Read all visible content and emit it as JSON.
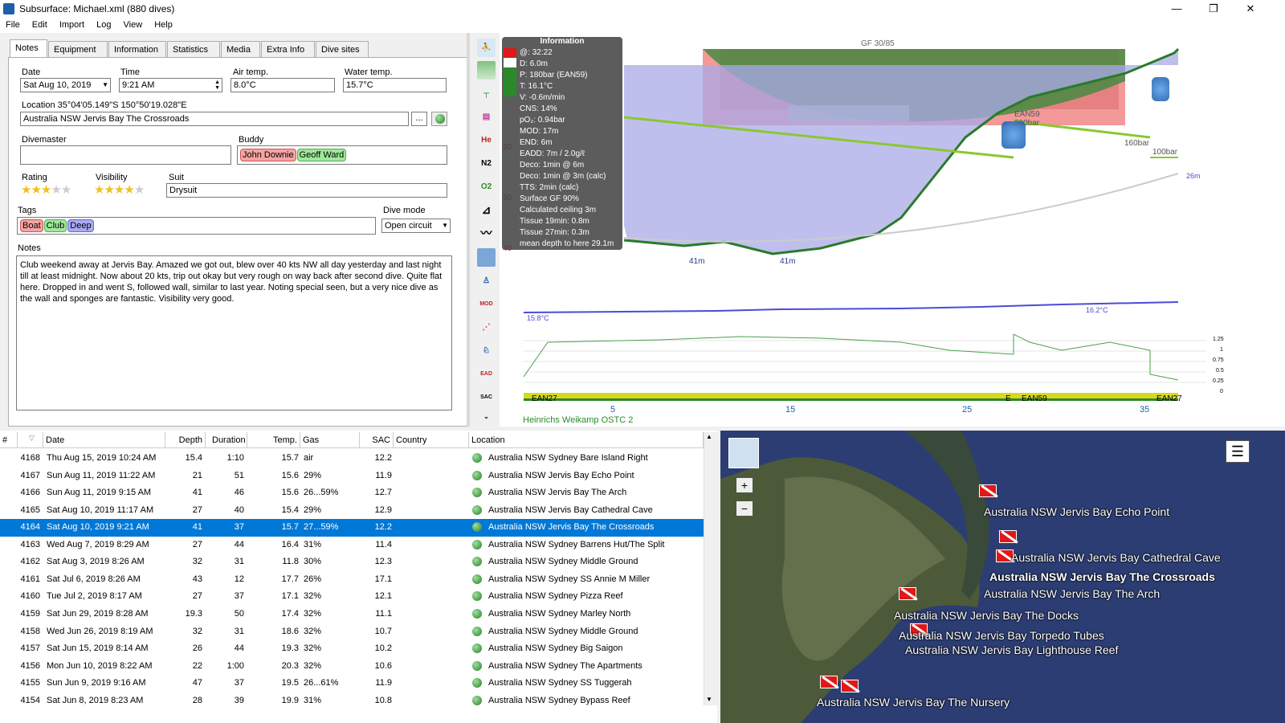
{
  "window": {
    "title": "Subsurface: Michael.xml (880 dives)",
    "minimize": "—",
    "restore": "❐",
    "close": "✕"
  },
  "menu": [
    "File",
    "Edit",
    "Import",
    "Log",
    "View",
    "Help"
  ],
  "tabs": [
    "Notes",
    "Equipment",
    "Information",
    "Statistics",
    "Media",
    "Extra Info",
    "Dive sites"
  ],
  "notes": {
    "date_label": "Date",
    "date_value": "Sat Aug 10, 2019",
    "time_label": "Time",
    "time_value": "9:21 AM",
    "air_label": "Air temp.",
    "air_value": "8.0°C",
    "water_label": "Water temp.",
    "water_value": "15.7°C",
    "location_label": "Location 35°04'05.149\"S 150°50'19.028\"E",
    "location_value": "Australia NSW Jervis Bay The Crossroads",
    "location_btn": "...",
    "divemaster_label": "Divemaster",
    "divemaster_value": "",
    "buddy_label": "Buddy",
    "buddies": [
      "John Downie",
      "Geoff Ward"
    ],
    "rating_label": "Rating",
    "rating": 3,
    "visibility_label": "Visibility",
    "visibility": 4,
    "suit_label": "Suit",
    "suit_value": "Drysuit",
    "tags_label": "Tags",
    "tags": [
      "Boat",
      "Club",
      "Deep"
    ],
    "divemode_label": "Dive mode",
    "divemode_value": "Open circuit",
    "notes_label": "Notes",
    "notes_text": "Club weekend away at Jervis Bay. Amazed we got out, blew over 40 kts NW all day yesterday and last night till at least midnight. Now about 20 kts, trip out okay but very rough on way back after second dive. Quite flat here. Dropped in and went S, followed wall, similar to last year. Noting special seen, but a very nice dive as the wall and sponges are fantastic. Visibility very good."
  },
  "toolbar": [
    "profile-icon",
    "ceiling-icon",
    "deco-icon",
    "tissue-icon",
    "He",
    "N2",
    "O2",
    "mod-icon",
    "graph-icon",
    "map-icon",
    "diver-icon",
    "MOD",
    "planner-icon",
    "gas-icon",
    "EAD",
    "SAC"
  ],
  "profile": {
    "gf_label": "GF 30/85",
    "info_title": "Information",
    "info_lines": [
      "@: 32:22",
      "D: 6.0m",
      "P: 180bar (EAN59)",
      "T: 16.1°C",
      "V: -0.6m/min",
      "CNS: 14%",
      "pO₂: 0.94bar",
      "MOD: 17m",
      "END: 6m",
      "EADD: 7m / 2.0g/ℓ",
      "Deco: 1min @ 6m",
      "Deco: 1min @ 3m (calc)",
      "TTS: 2min (calc)",
      "Surface GF 90%",
      "Calculated ceiling 3m",
      "Tissue 19min: 0.8m",
      "Tissue 27min: 0.3m",
      "mean depth to here 29.1m"
    ],
    "depth_ticks": [
      "20",
      "30",
      "40"
    ],
    "depth_labels": [
      "41m",
      "41m"
    ],
    "pressure_labels": [
      "EAN59",
      "200bar",
      "160bar",
      "100bar"
    ],
    "max_label": "26m",
    "temp_labels": [
      "15.8°C",
      "16.2°C"
    ],
    "po2_ticks": [
      "1.25",
      "1",
      "0.75",
      "0.5",
      "0.25",
      "0"
    ],
    "gas_labels": [
      "EAN27",
      "E",
      "EAN59",
      "EAN27"
    ],
    "time_ticks": [
      "5",
      "15",
      "25",
      "35"
    ],
    "computer": "Heinrichs Weikamp OSTC 2"
  },
  "divelist": {
    "headers": [
      "#",
      "Date",
      "Depth",
      "Duration",
      "Temp.",
      "Gas",
      "SAC",
      "Country",
      "Location"
    ],
    "rows": [
      {
        "n": "4168",
        "date": "Thu Aug 15, 2019 10:24 AM",
        "depth": "15.4",
        "dur": "1:10",
        "temp": "15.7",
        "gas": "air",
        "sac": "12.2",
        "loc": "Australia NSW Sydney Bare Island Right"
      },
      {
        "n": "4167",
        "date": "Sun Aug 11, 2019 11:22 AM",
        "depth": "21",
        "dur": "51",
        "temp": "15.6",
        "gas": "29%",
        "sac": "11.9",
        "loc": "Australia NSW Jervis Bay Echo Point"
      },
      {
        "n": "4166",
        "date": "Sun Aug 11, 2019 9:15 AM",
        "depth": "41",
        "dur": "46",
        "temp": "15.6",
        "gas": "26...59%",
        "sac": "12.7",
        "loc": "Australia NSW Jervis Bay The Arch"
      },
      {
        "n": "4165",
        "date": "Sat Aug 10, 2019 11:17 AM",
        "depth": "27",
        "dur": "40",
        "temp": "15.4",
        "gas": "29%",
        "sac": "12.9",
        "loc": "Australia NSW Jervis Bay Cathedral Cave"
      },
      {
        "n": "4164",
        "date": "Sat Aug 10, 2019 9:21 AM",
        "depth": "41",
        "dur": "37",
        "temp": "15.7",
        "gas": "27...59%",
        "sac": "12.2",
        "loc": "Australia NSW Jervis Bay The Crossroads",
        "sel": true
      },
      {
        "n": "4163",
        "date": "Wed Aug 7, 2019 8:29 AM",
        "depth": "27",
        "dur": "44",
        "temp": "16.4",
        "gas": "31%",
        "sac": "11.4",
        "loc": "Australia NSW Sydney Barrens Hut/The Split"
      },
      {
        "n": "4162",
        "date": "Sat Aug 3, 2019 8:26 AM",
        "depth": "32",
        "dur": "31",
        "temp": "11.8",
        "gas": "30%",
        "sac": "12.3",
        "loc": "Australia NSW Sydney Middle Ground"
      },
      {
        "n": "4161",
        "date": "Sat Jul 6, 2019 8:26 AM",
        "depth": "43",
        "dur": "12",
        "temp": "17.7",
        "gas": "26%",
        "sac": "17.1",
        "loc": "Australia NSW Sydney SS Annie M Miller"
      },
      {
        "n": "4160",
        "date": "Tue Jul 2, 2019 8:17 AM",
        "depth": "27",
        "dur": "37",
        "temp": "17.1",
        "gas": "32%",
        "sac": "12.1",
        "loc": "Australia NSW Sydney Pizza Reef"
      },
      {
        "n": "4159",
        "date": "Sat Jun 29, 2019 8:28 AM",
        "depth": "19.3",
        "dur": "50",
        "temp": "17.4",
        "gas": "32%",
        "sac": "11.1",
        "loc": "Australia NSW Sydney Marley North"
      },
      {
        "n": "4158",
        "date": "Wed Jun 26, 2019 8:19 AM",
        "depth": "32",
        "dur": "31",
        "temp": "18.6",
        "gas": "32%",
        "sac": "10.7",
        "loc": "Australia NSW Sydney Middle Ground"
      },
      {
        "n": "4157",
        "date": "Sat Jun 15, 2019 8:14 AM",
        "depth": "26",
        "dur": "44",
        "temp": "19.3",
        "gas": "32%",
        "sac": "10.2",
        "loc": "Australia NSW Sydney Big Saigon"
      },
      {
        "n": "4156",
        "date": "Mon Jun 10, 2019 8:22 AM",
        "depth": "22",
        "dur": "1:00",
        "temp": "20.3",
        "gas": "32%",
        "sac": "10.6",
        "loc": "Australia NSW Sydney The Apartments"
      },
      {
        "n": "4155",
        "date": "Sun Jun 9, 2019 9:16 AM",
        "depth": "47",
        "dur": "37",
        "temp": "19.5",
        "gas": "26...61%",
        "sac": "11.9",
        "loc": "Australia NSW Sydney SS Tuggerah"
      },
      {
        "n": "4154",
        "date": "Sat Jun 8, 2019 8:23 AM",
        "depth": "28",
        "dur": "39",
        "temp": "19.9",
        "gas": "31%",
        "sac": "10.8",
        "loc": "Australia NSW Sydney Bypass Reef"
      }
    ]
  },
  "map": {
    "zoom_in": "+",
    "zoom_out": "−",
    "menu": "☰",
    "labels": [
      "Australia NSW Jervis Bay Echo Point",
      "Australia NSW Jervis Bay Cathedral Cave",
      "Australia NSW Jervis Bay The Crossroads",
      "Australia NSW Jervis Bay The Arch",
      "Australia NSW Jervis Bay The Docks",
      "Australia NSW Jervis Bay Torpedo Tubes",
      "Australia NSW Jervis Bay Lighthouse Reef",
      "Australia NSW Jervis Bay The Nursery"
    ]
  }
}
